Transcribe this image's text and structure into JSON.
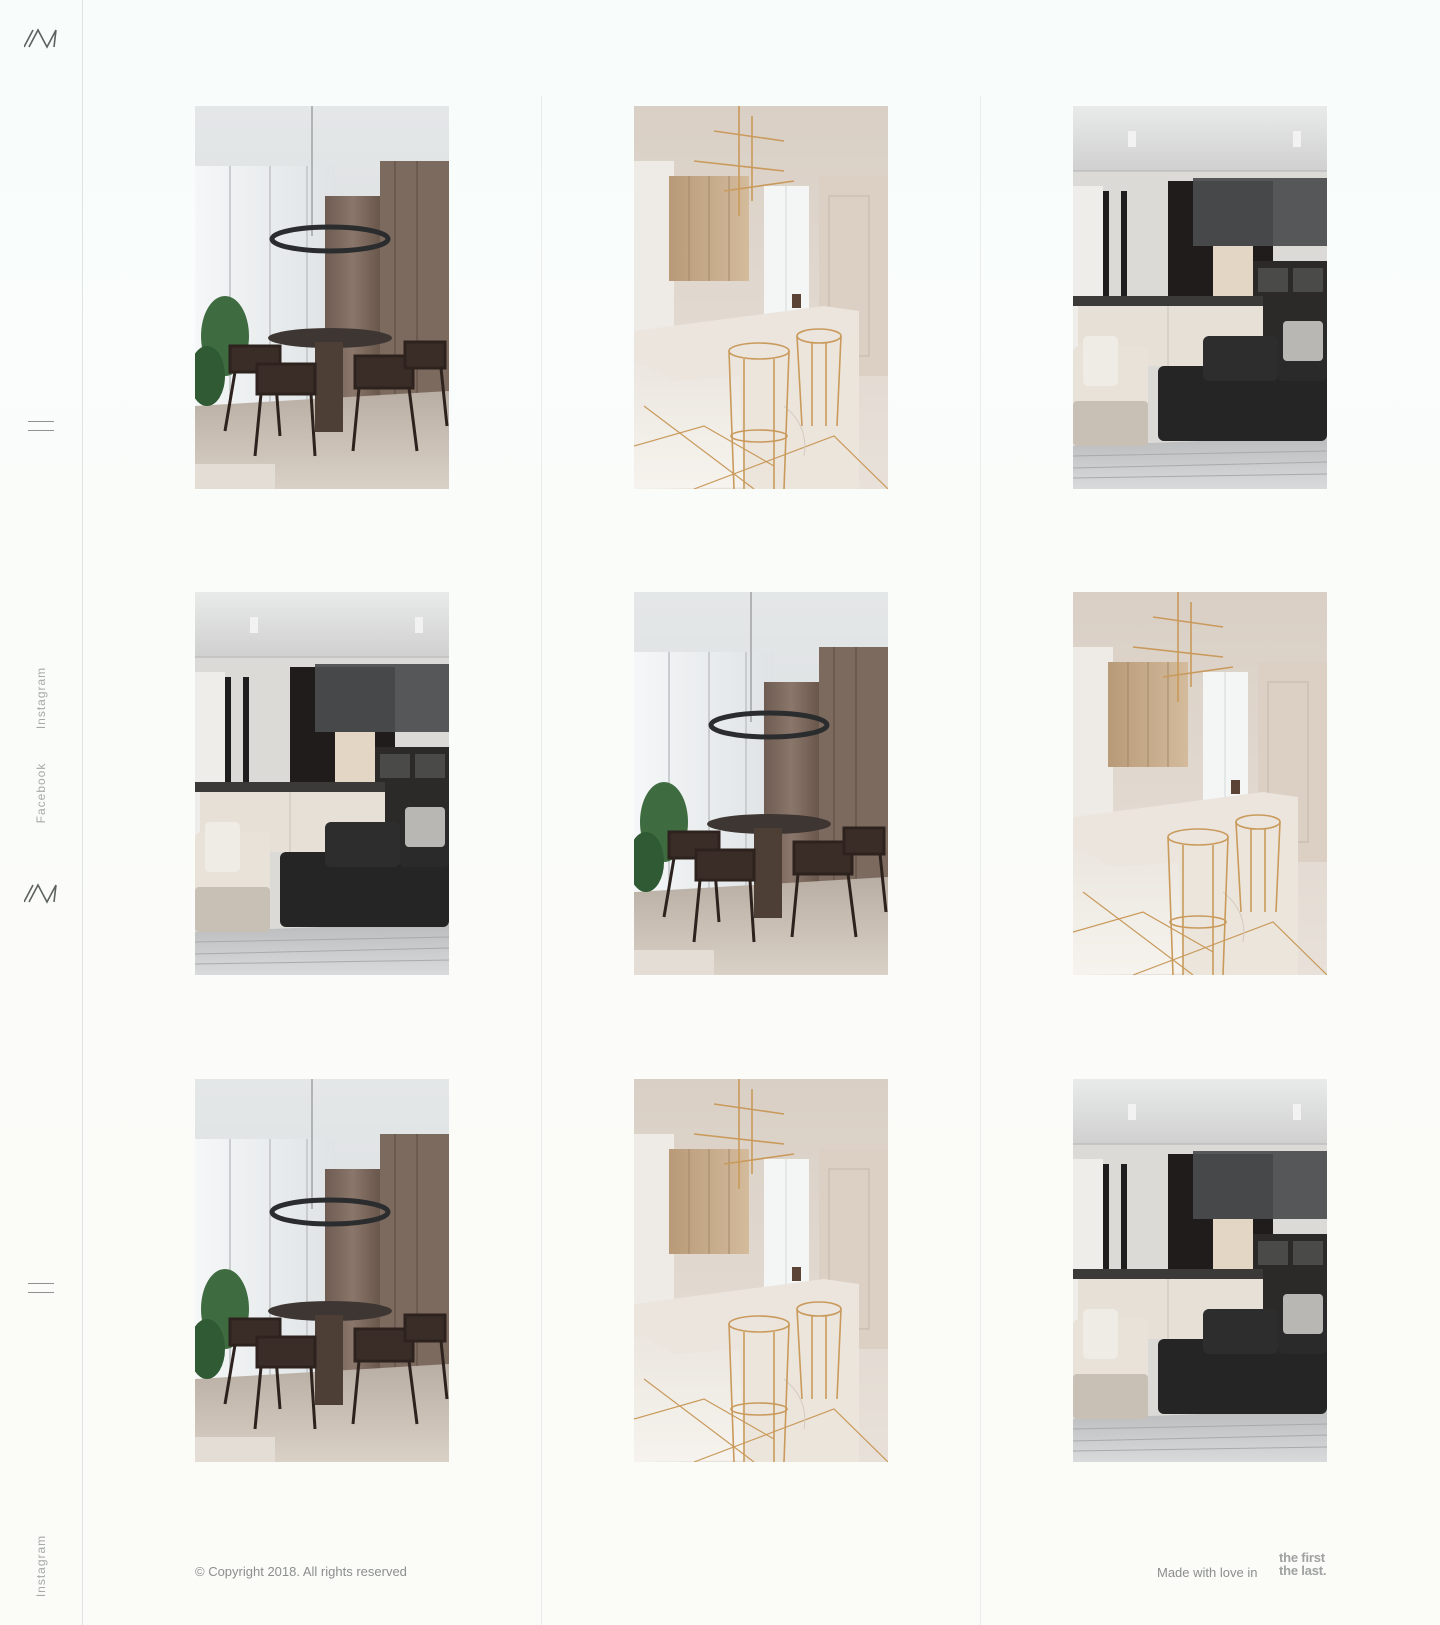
{
  "sidebar": {
    "menu_label": "Menu",
    "social_links": [
      "Instagram",
      "Facebook",
      "Instagram"
    ]
  },
  "gallery": {
    "images": [
      {
        "scene": "dining-room",
        "alt": "Dining room with ring chandelier"
      },
      {
        "scene": "kitchen-gold",
        "alt": "Marble kitchen with gold bar stools"
      },
      {
        "scene": "living-room",
        "alt": "Living room with dark sofa"
      },
      {
        "scene": "living-room",
        "alt": "Living room with dark sofa"
      },
      {
        "scene": "dining-room",
        "alt": "Dining room with ring chandelier"
      },
      {
        "scene": "kitchen-gold",
        "alt": "Marble kitchen with gold bar stools"
      },
      {
        "scene": "dining-room",
        "alt": "Dining room with ring chandelier"
      },
      {
        "scene": "kitchen-gold",
        "alt": "Marble kitchen with gold bar stools"
      },
      {
        "scene": "living-room",
        "alt": "Living room with dark sofa"
      }
    ]
  },
  "footer": {
    "copyright": "© Copyright 2018. All rights reserved",
    "made_with": "Made with love in",
    "brand_line1": "the first",
    "brand_line2": "the last."
  },
  "colors": {
    "background": "#f9fcfa",
    "text_muted": "#8c8f8e",
    "divider": "#e9ecea",
    "gold_accent": "#c99a5b"
  },
  "icons": {
    "logo": "monogram-logo-icon",
    "menu": "hamburger-menu-icon"
  }
}
